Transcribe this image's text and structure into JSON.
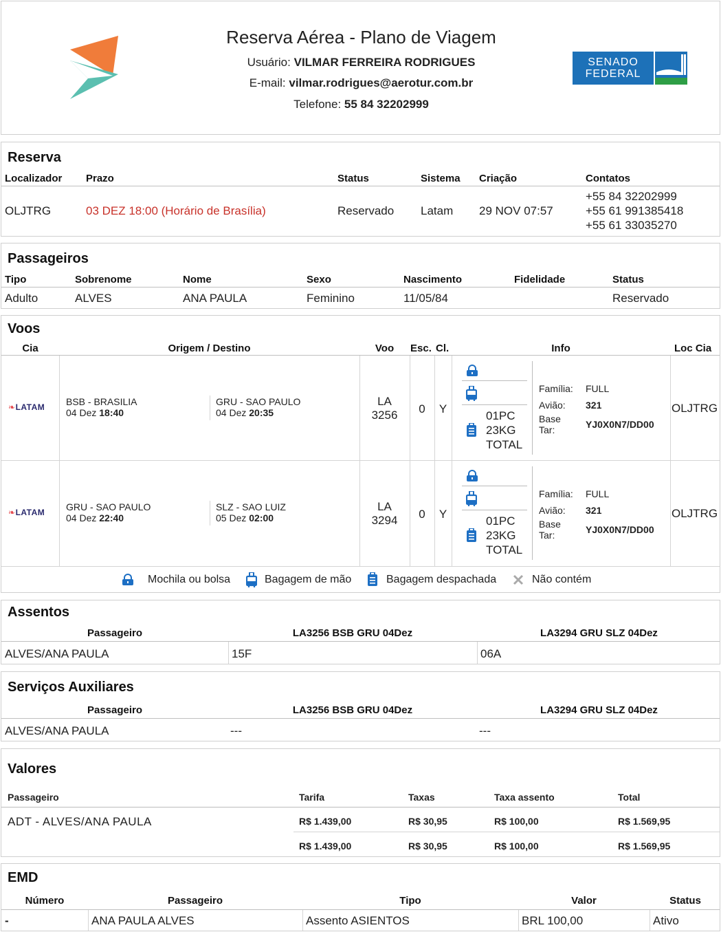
{
  "header": {
    "title": "Reserva Aérea - Plano de Viagem",
    "usuario_label": "Usuário:",
    "usuario": "VILMAR FERREIRA RODRIGUES",
    "email_label": "E-mail:",
    "email": "vilmar.rodrigues@aerotur.com.br",
    "telefone_label": "Telefone:",
    "telefone": "55 84 32202999",
    "senado_logo_line1": "SENADO",
    "senado_logo_line2": "FEDERAL",
    "colors": {
      "orange": "#f07c3a",
      "teal": "#5bbfb0",
      "senado_blue": "#1d71b8",
      "senado_green": "#2e9e46"
    }
  },
  "reserva": {
    "title": "Reserva",
    "columns": [
      "Localizador",
      "Prazo",
      "Status",
      "Sistema",
      "Criação",
      "Contatos"
    ],
    "localizador": "OLJTRG",
    "prazo": "03 DEZ 18:00 (Horário de Brasília)",
    "status": "Reservado",
    "sistema": "Latam",
    "criacao": "29 NOV 07:57",
    "contatos": [
      "+55 84 32202999",
      "+55 61 991385418",
      "+55 61 33035270"
    ]
  },
  "passageiros": {
    "title": "Passageiros",
    "columns": [
      "Tipo",
      "Sobrenome",
      "Nome",
      "Sexo",
      "Nascimento",
      "Fidelidade",
      "Status"
    ],
    "rows": [
      {
        "tipo": "Adulto",
        "sobrenome": "ALVES",
        "nome": "ANA PAULA",
        "sexo": "Feminino",
        "nascimento": "11/05/84",
        "fidelidade": "",
        "status": "Reservado"
      }
    ]
  },
  "voos": {
    "title": "Voos",
    "columns": [
      "Cia",
      "Origem / Destino",
      "Voo",
      "Esc.",
      "Cl.",
      "Info",
      "Loc Cia"
    ],
    "rows": [
      {
        "cia": "LATAM",
        "origem": "BSB - BRASILIA",
        "origem_data": "04 Dez",
        "origem_hora": "18:40",
        "destino": "GRU - SAO PAULO",
        "destino_data": "04 Dez",
        "destino_hora": "20:35",
        "voo_l1": "LA",
        "voo_l2": "3256",
        "esc": "0",
        "cl": "Y",
        "bag_l1": "01PC",
        "bag_l2": "23KG",
        "bag_l3": "TOTAL",
        "familia_label": "Família:",
        "familia": "FULL",
        "aviao_label": "Avião:",
        "aviao": "321",
        "base_label1": "Base",
        "base_label2": "Tar:",
        "base": "YJ0X0N7/DD00",
        "loc": "OLJTRG"
      },
      {
        "cia": "LATAM",
        "origem": "GRU - SAO PAULO",
        "origem_data": "04 Dez",
        "origem_hora": "22:40",
        "destino": "SLZ - SAO LUIZ",
        "destino_data": "05 Dez",
        "destino_hora": "02:00",
        "voo_l1": "LA",
        "voo_l2": "3294",
        "esc": "0",
        "cl": "Y",
        "bag_l1": "01PC",
        "bag_l2": "23KG",
        "bag_l3": "TOTAL",
        "familia_label": "Família:",
        "familia": "FULL",
        "aviao_label": "Avião:",
        "aviao": "321",
        "base_label1": "Base",
        "base_label2": "Tar:",
        "base": "YJ0X0N7/DD00",
        "loc": "OLJTRG"
      }
    ],
    "legend": {
      "mochila": "Mochila ou bolsa",
      "mao": "Bagagem de mão",
      "despachada": "Bagagem despachada",
      "nao_contem": "Não contém"
    },
    "icon_color": "#1d6fc4"
  },
  "assentos": {
    "title": "Assentos",
    "columns": [
      "Passageiro",
      "LA3256 BSB GRU 04Dez",
      "LA3294 GRU SLZ 04Dez"
    ],
    "row": [
      "ALVES/ANA PAULA",
      "15F",
      "06A"
    ]
  },
  "servicos": {
    "title": "Serviços Auxiliares",
    "columns": [
      "Passageiro",
      "LA3256 BSB GRU 04Dez",
      "LA3294 GRU SLZ 04Dez"
    ],
    "row": [
      "ALVES/ANA PAULA",
      "---",
      "---"
    ]
  },
  "valores": {
    "title": "Valores",
    "columns": [
      "Passageiro",
      "Tarifa",
      "Taxas",
      "Taxa assento",
      "Total"
    ],
    "row": [
      "ADT - ALVES/ANA PAULA",
      "R$ 1.439,00",
      "R$ 30,95",
      "R$ 100,00",
      "R$ 1.569,95"
    ],
    "totals": [
      "R$ 1.439,00",
      "R$ 30,95",
      "R$ 100,00",
      "R$ 1.569,95"
    ]
  },
  "emd": {
    "title": "EMD",
    "columns": [
      "Número",
      "Passageiro",
      "Tipo",
      "Valor",
      "Status"
    ],
    "row": [
      "-",
      "ANA PAULA ALVES",
      "Assento ASIENTOS",
      "BRL 100,00",
      "Ativo"
    ]
  }
}
